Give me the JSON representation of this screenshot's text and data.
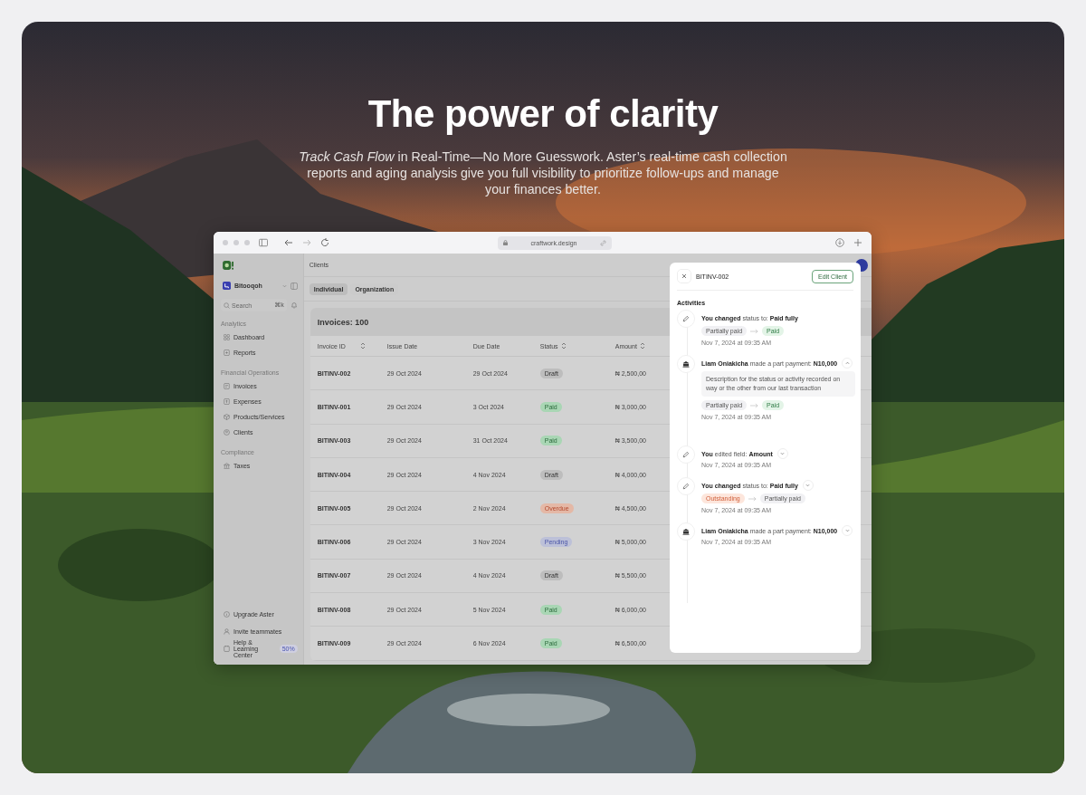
{
  "hero": {
    "title": "The power of clarity",
    "subtitle": "*Track Cash Flow* in Real-Time—No More Guesswork. Aster’s real-time cash collection reports and aging analysis give you full visibility to prioritize follow-ups and manage your finances better."
  },
  "browser": {
    "url": "craftwork.design"
  },
  "sidebar": {
    "workspace": "Bitooqoh",
    "search": {
      "placeholder": "Search",
      "shortcut": "⌘k"
    },
    "sections": [
      {
        "title": "Analytics",
        "items": [
          {
            "label": "Dashboard"
          },
          {
            "label": "Reports"
          }
        ]
      },
      {
        "title": "Financial Operations",
        "items": [
          {
            "label": "Invoices"
          },
          {
            "label": "Expenses"
          },
          {
            "label": "Products/Services"
          },
          {
            "label": "Clients"
          }
        ]
      },
      {
        "title": "Compliance",
        "items": [
          {
            "label": "Taxes"
          }
        ]
      }
    ],
    "footer": [
      {
        "label": "Upgrade Aster"
      },
      {
        "label": "Invite teammates"
      },
      {
        "label": "Help & Learning Center",
        "badge": "50%"
      }
    ]
  },
  "main": {
    "breadcrumb": "Clients",
    "tabs": [
      {
        "label": "Individual",
        "selected": true
      },
      {
        "label": "Organization",
        "selected": false
      }
    ],
    "table": {
      "title": "Invoices: 100",
      "columns": [
        {
          "label": "Invoice ID",
          "sortable": true
        },
        {
          "label": "Issue Date",
          "sortable": false
        },
        {
          "label": "Due Date",
          "sortable": false
        },
        {
          "label": "Status",
          "sortable": true
        },
        {
          "label": "Amount",
          "sortable": true
        }
      ],
      "rows": [
        {
          "id": "BITINV-002",
          "issue": "29 Oct 2024",
          "due": "29 Oct 2024",
          "status": {
            "label": "Draft",
            "kind": "draft"
          },
          "amount": "₦ 2,500,00"
        },
        {
          "id": "BITINV-001",
          "issue": "29 Oct 2024",
          "due": "3 Oct 2024",
          "status": {
            "label": "Paid",
            "kind": "paid"
          },
          "amount": "₦ 3,000,00"
        },
        {
          "id": "BITINV-003",
          "issue": "29 Oct 2024",
          "due": "31 Oct 2024",
          "status": {
            "label": "Paid",
            "kind": "paid"
          },
          "amount": "₦ 3,500,00"
        },
        {
          "id": "BITINV-004",
          "issue": "29 Oct 2024",
          "due": "4 Nov 2024",
          "status": {
            "label": "Draft",
            "kind": "draft"
          },
          "amount": "₦ 4,000,00"
        },
        {
          "id": "BITINV-005",
          "issue": "29 Oct 2024",
          "due": "2 Nov 2024",
          "status": {
            "label": "Overdue",
            "kind": "overdue"
          },
          "amount": "₦ 4,500,00"
        },
        {
          "id": "BITINV-006",
          "issue": "29 Oct 2024",
          "due": "3 Nov 2024",
          "status": {
            "label": "Pending",
            "kind": "pending"
          },
          "amount": "₦ 5,000,00"
        },
        {
          "id": "BITINV-007",
          "issue": "29 Oct 2024",
          "due": "4 Nov 2024",
          "status": {
            "label": "Draft",
            "kind": "draft"
          },
          "amount": "₦ 5,500,00"
        },
        {
          "id": "BITINV-008",
          "issue": "29 Oct 2024",
          "due": "5 Nov 2024",
          "status": {
            "label": "Paid",
            "kind": "paid"
          },
          "amount": "₦ 6,000,00"
        },
        {
          "id": "BITINV-009",
          "issue": "29 Oct 2024",
          "due": "6 Nov 2024",
          "status": {
            "label": "Paid",
            "kind": "paid"
          },
          "amount": "₦ 6,500,00"
        }
      ]
    }
  },
  "panel": {
    "title": "BITINV-002",
    "button": "Edit Client",
    "section": "Activities",
    "activities": [
      {
        "kind": "edit",
        "text": "**You changed** status to: **Paid fully**",
        "from": {
          "label": "Partially paid",
          "kind": "partial"
        },
        "to": {
          "label": "Paid",
          "kind": "paid"
        },
        "time": "Nov 7, 2024 at 09:35 AM"
      },
      {
        "kind": "payment",
        "text": "**Liam Oniakicha** made a part payment: **N10,000**",
        "expanded": true,
        "description": "Description for the status or activity recorded on way or the other from our last transaction",
        "from": {
          "label": "Partially paid",
          "kind": "partial"
        },
        "to": {
          "label": "Paid",
          "kind": "paid"
        },
        "time": "Nov 7, 2024 at 09:35 AM"
      },
      {
        "kind": "edit",
        "text": "**You** edited field: **Amount**",
        "expanded": false,
        "time": "Nov 7, 2024 at 09:35 AM"
      },
      {
        "kind": "edit",
        "text": "**You changed** status to: **Paid fully**",
        "expanded": false,
        "from": {
          "label": "Outstanding",
          "kind": "outstanding"
        },
        "to": {
          "label": "Partially paid",
          "kind": "partial"
        },
        "time": "Nov 7, 2024 at 09:35 AM"
      },
      {
        "kind": "payment",
        "text": "**Liam Oniakicha** made a part payment: **N10,000**",
        "expanded": false,
        "time": "Nov 7, 2024 at 09:35 AM"
      }
    ]
  }
}
